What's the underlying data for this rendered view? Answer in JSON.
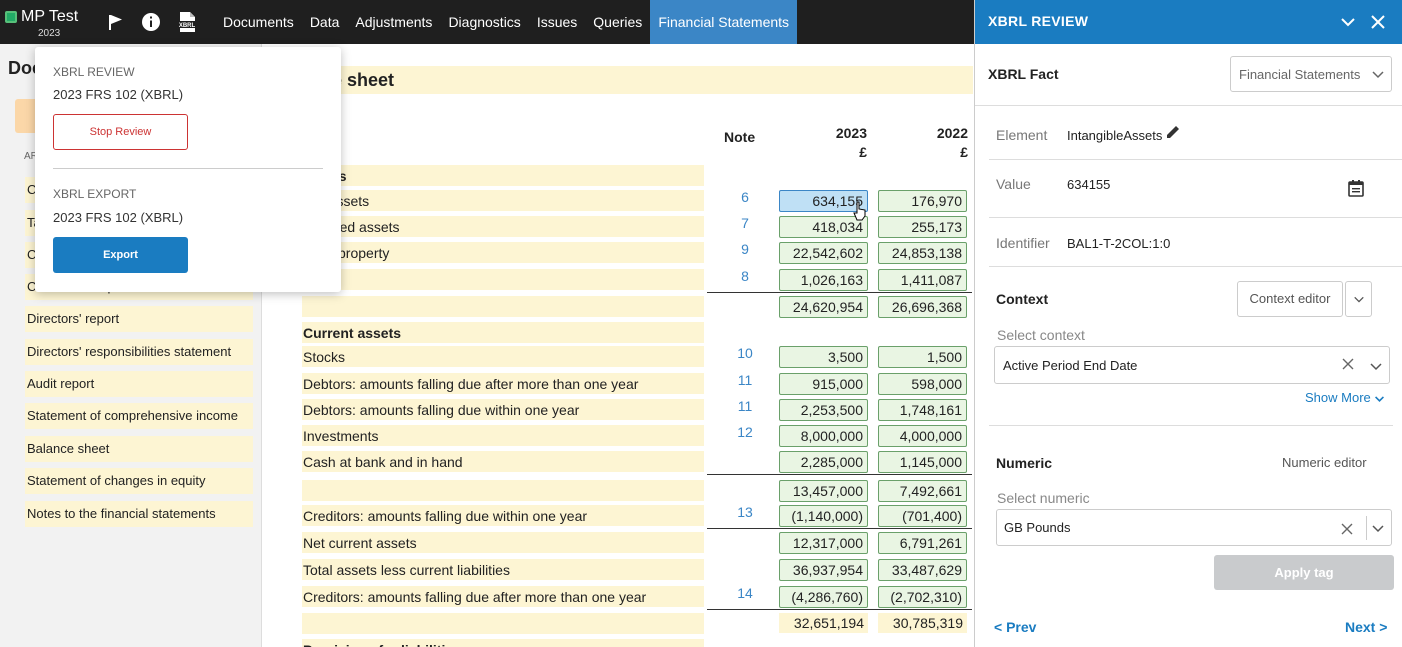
{
  "app": {
    "name": "MP Test",
    "year": "2023"
  },
  "toolbar": {
    "icons": [
      "flag-icon",
      "info-icon",
      "xbrl-icon"
    ],
    "xbrl_icon_label": "XBRL"
  },
  "nav": {
    "items": [
      "Documents",
      "Data",
      "Adjustments",
      "Diagnostics",
      "Issues",
      "Queries",
      "Financial Statements"
    ],
    "active": "Financial Statements"
  },
  "sidebar": {
    "title": "Doc",
    "section_caption": "AR",
    "items": [
      "C",
      "Ta",
      "C",
      "Chairman's report",
      "Directors' report",
      "Directors' responsibilities statement",
      "Audit report",
      "Statement of comprehensive income",
      "Balance sheet",
      "Statement of changes in equity",
      "Notes to the financial statements"
    ]
  },
  "popover": {
    "review_caption": "XBRL REVIEW",
    "review_sub": "2023 FRS 102 (XBRL)",
    "stop_label": "Stop Review",
    "export_caption": "XBRL EXPORT",
    "export_sub": "2023 FRS 102 (XBRL)",
    "export_label": "Export"
  },
  "document": {
    "title": "ance sheet",
    "note_header": "Note",
    "year1": "2023",
    "year2": "2022",
    "currency": "£",
    "rows": [
      {
        "label": "assets",
        "bold": true,
        "note": "",
        "v1": "",
        "v2": ""
      },
      {
        "label": "ible assets",
        "bold": false,
        "note": "6",
        "v1": "634,155",
        "v2": "176,970"
      },
      {
        "label": "ble fixed assets",
        "bold": false,
        "note": "7",
        "v1": "418,034",
        "v2": "255,173"
      },
      {
        "label": "ment property",
        "bold": false,
        "note": "9",
        "v1": "22,542,602",
        "v2": "24,853,138"
      },
      {
        "label": "ments",
        "bold": false,
        "note": "8",
        "v1": "1,026,163",
        "v2": "1,411,087"
      },
      {
        "label": "",
        "bold": false,
        "note": "",
        "v1": "24,620,954",
        "v2": "26,696,368"
      },
      {
        "label": "Current assets",
        "bold": true,
        "note": "",
        "v1": "",
        "v2": ""
      },
      {
        "label": "Stocks",
        "bold": false,
        "note": "10",
        "v1": "3,500",
        "v2": "1,500"
      },
      {
        "label": "Debtors: amounts falling due after more than one year",
        "bold": false,
        "note": "11",
        "v1": "915,000",
        "v2": "598,000"
      },
      {
        "label": "Debtors: amounts falling due within one year",
        "bold": false,
        "note": "11",
        "v1": "2,253,500",
        "v2": "1,748,161"
      },
      {
        "label": "Investments",
        "bold": false,
        "note": "12",
        "v1": "8,000,000",
        "v2": "4,000,000"
      },
      {
        "label": "Cash at bank and in hand",
        "bold": false,
        "note": "",
        "v1": "2,285,000",
        "v2": "1,145,000"
      },
      {
        "label": "",
        "bold": false,
        "note": "",
        "v1": "13,457,000",
        "v2": "7,492,661"
      },
      {
        "label": "Creditors: amounts falling due within one year",
        "bold": false,
        "note": "13",
        "v1": "(1,140,000)",
        "v2": "(701,400)"
      },
      {
        "label": "Net current assets",
        "bold": false,
        "note": "",
        "v1": "12,317,000",
        "v2": "6,791,261"
      },
      {
        "label": "Total assets less current liabilities",
        "bold": false,
        "note": "",
        "v1": "36,937,954",
        "v2": "33,487,629"
      },
      {
        "label": "Creditors: amounts falling due after more than one year",
        "bold": false,
        "note": "14",
        "v1": "(4,286,760)",
        "v2": "(2,702,310)"
      },
      {
        "label": "",
        "bold": false,
        "note": "",
        "v1": "32,651,194",
        "v2": "30,785,319"
      },
      {
        "label": "Provisions for liabilities",
        "bold": true,
        "note": "",
        "v1": "",
        "v2": ""
      }
    ]
  },
  "panel": {
    "title": "XBRL REVIEW",
    "fact_heading": "XBRL Fact",
    "fact_select": "Financial Statements",
    "element_label": "Element",
    "element_value": "IntangibleAssets",
    "value_label": "Value",
    "value_value": "634155",
    "identifier_label": "Identifier",
    "identifier_value": "BAL1-T-2COL:1:0",
    "context_heading": "Context",
    "context_editor": "Context editor",
    "select_context_label": "Select context",
    "context_value": "Active Period End Date",
    "show_more": "Show More",
    "numeric_heading": "Numeric",
    "numeric_editor": "Numeric editor",
    "select_numeric_label": "Select numeric",
    "numeric_value": "GB Pounds",
    "apply_label": "Apply tag",
    "prev_label": "< Prev",
    "next_label": "Next >"
  }
}
